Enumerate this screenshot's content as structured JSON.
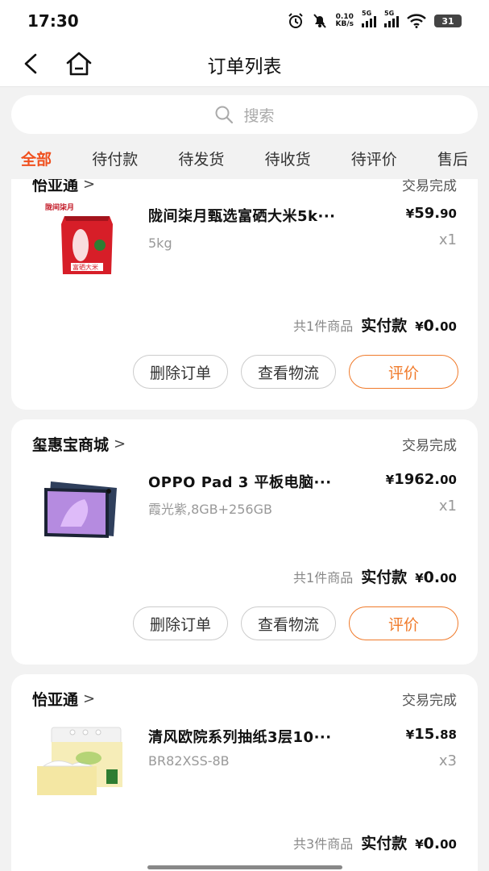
{
  "status_bar": {
    "time": "17:30",
    "net_speed_value": "0.10",
    "net_speed_unit": "KB/s",
    "signal_1": "5G",
    "signal_2": "5G",
    "battery": "31",
    "icons": [
      "alarm-icon",
      "mute-icon",
      "signal-icon",
      "wifi-icon",
      "battery-icon"
    ]
  },
  "nav": {
    "title": "订单列表",
    "back_icon": "chevron-left-icon",
    "home_icon": "home-icon"
  },
  "search": {
    "placeholder": "搜索",
    "icon": "search-icon"
  },
  "tabs": [
    {
      "label": "全部",
      "active": true
    },
    {
      "label": "待付款"
    },
    {
      "label": "待发货"
    },
    {
      "label": "待收货"
    },
    {
      "label": "待评价"
    },
    {
      "label": "售后"
    }
  ],
  "colors": {
    "accent": "#f0501e",
    "button_accent": "#f07a2a",
    "background": "#f2f2f2"
  },
  "orders": [
    {
      "shop": "怡亚通",
      "status": "交易完成",
      "goods_name": "陇间柒月甄选富硒大米5k···",
      "spec": "5kg",
      "price_currency": "¥",
      "price_int": "59.",
      "price_dec": "90",
      "qty": "x1",
      "count_text": "共1件商品",
      "pay_label": "实付款",
      "pay_currency": "¥",
      "pay_int": "0.",
      "pay_dec": "00",
      "bag_label": "富硒大米",
      "brand_label": "陇间柒月",
      "buttons": [
        "删除订单",
        "查看物流",
        "评价"
      ]
    },
    {
      "shop": "玺惠宝商城",
      "status": "交易完成",
      "goods_name": "OPPO Pad 3 平板电脑···",
      "spec": "霞光紫,8GB+256GB",
      "price_currency": "¥",
      "price_int": "1962.",
      "price_dec": "00",
      "qty": "x1",
      "count_text": "共1件商品",
      "pay_label": "实付款",
      "pay_currency": "¥",
      "pay_int": "0.",
      "pay_dec": "00",
      "buttons": [
        "删除订单",
        "查看物流",
        "评价"
      ]
    },
    {
      "shop": "怡亚通",
      "status": "交易完成",
      "goods_name": "清风欧院系列抽纸3层10···",
      "spec": "BR82XSS-8B",
      "price_currency": "¥",
      "price_int": "15.",
      "price_dec": "88",
      "qty": "x3",
      "count_text": "共3件商品",
      "pay_label": "实付款",
      "pay_currency": "¥",
      "pay_int": "0.",
      "pay_dec": "00"
    }
  ]
}
